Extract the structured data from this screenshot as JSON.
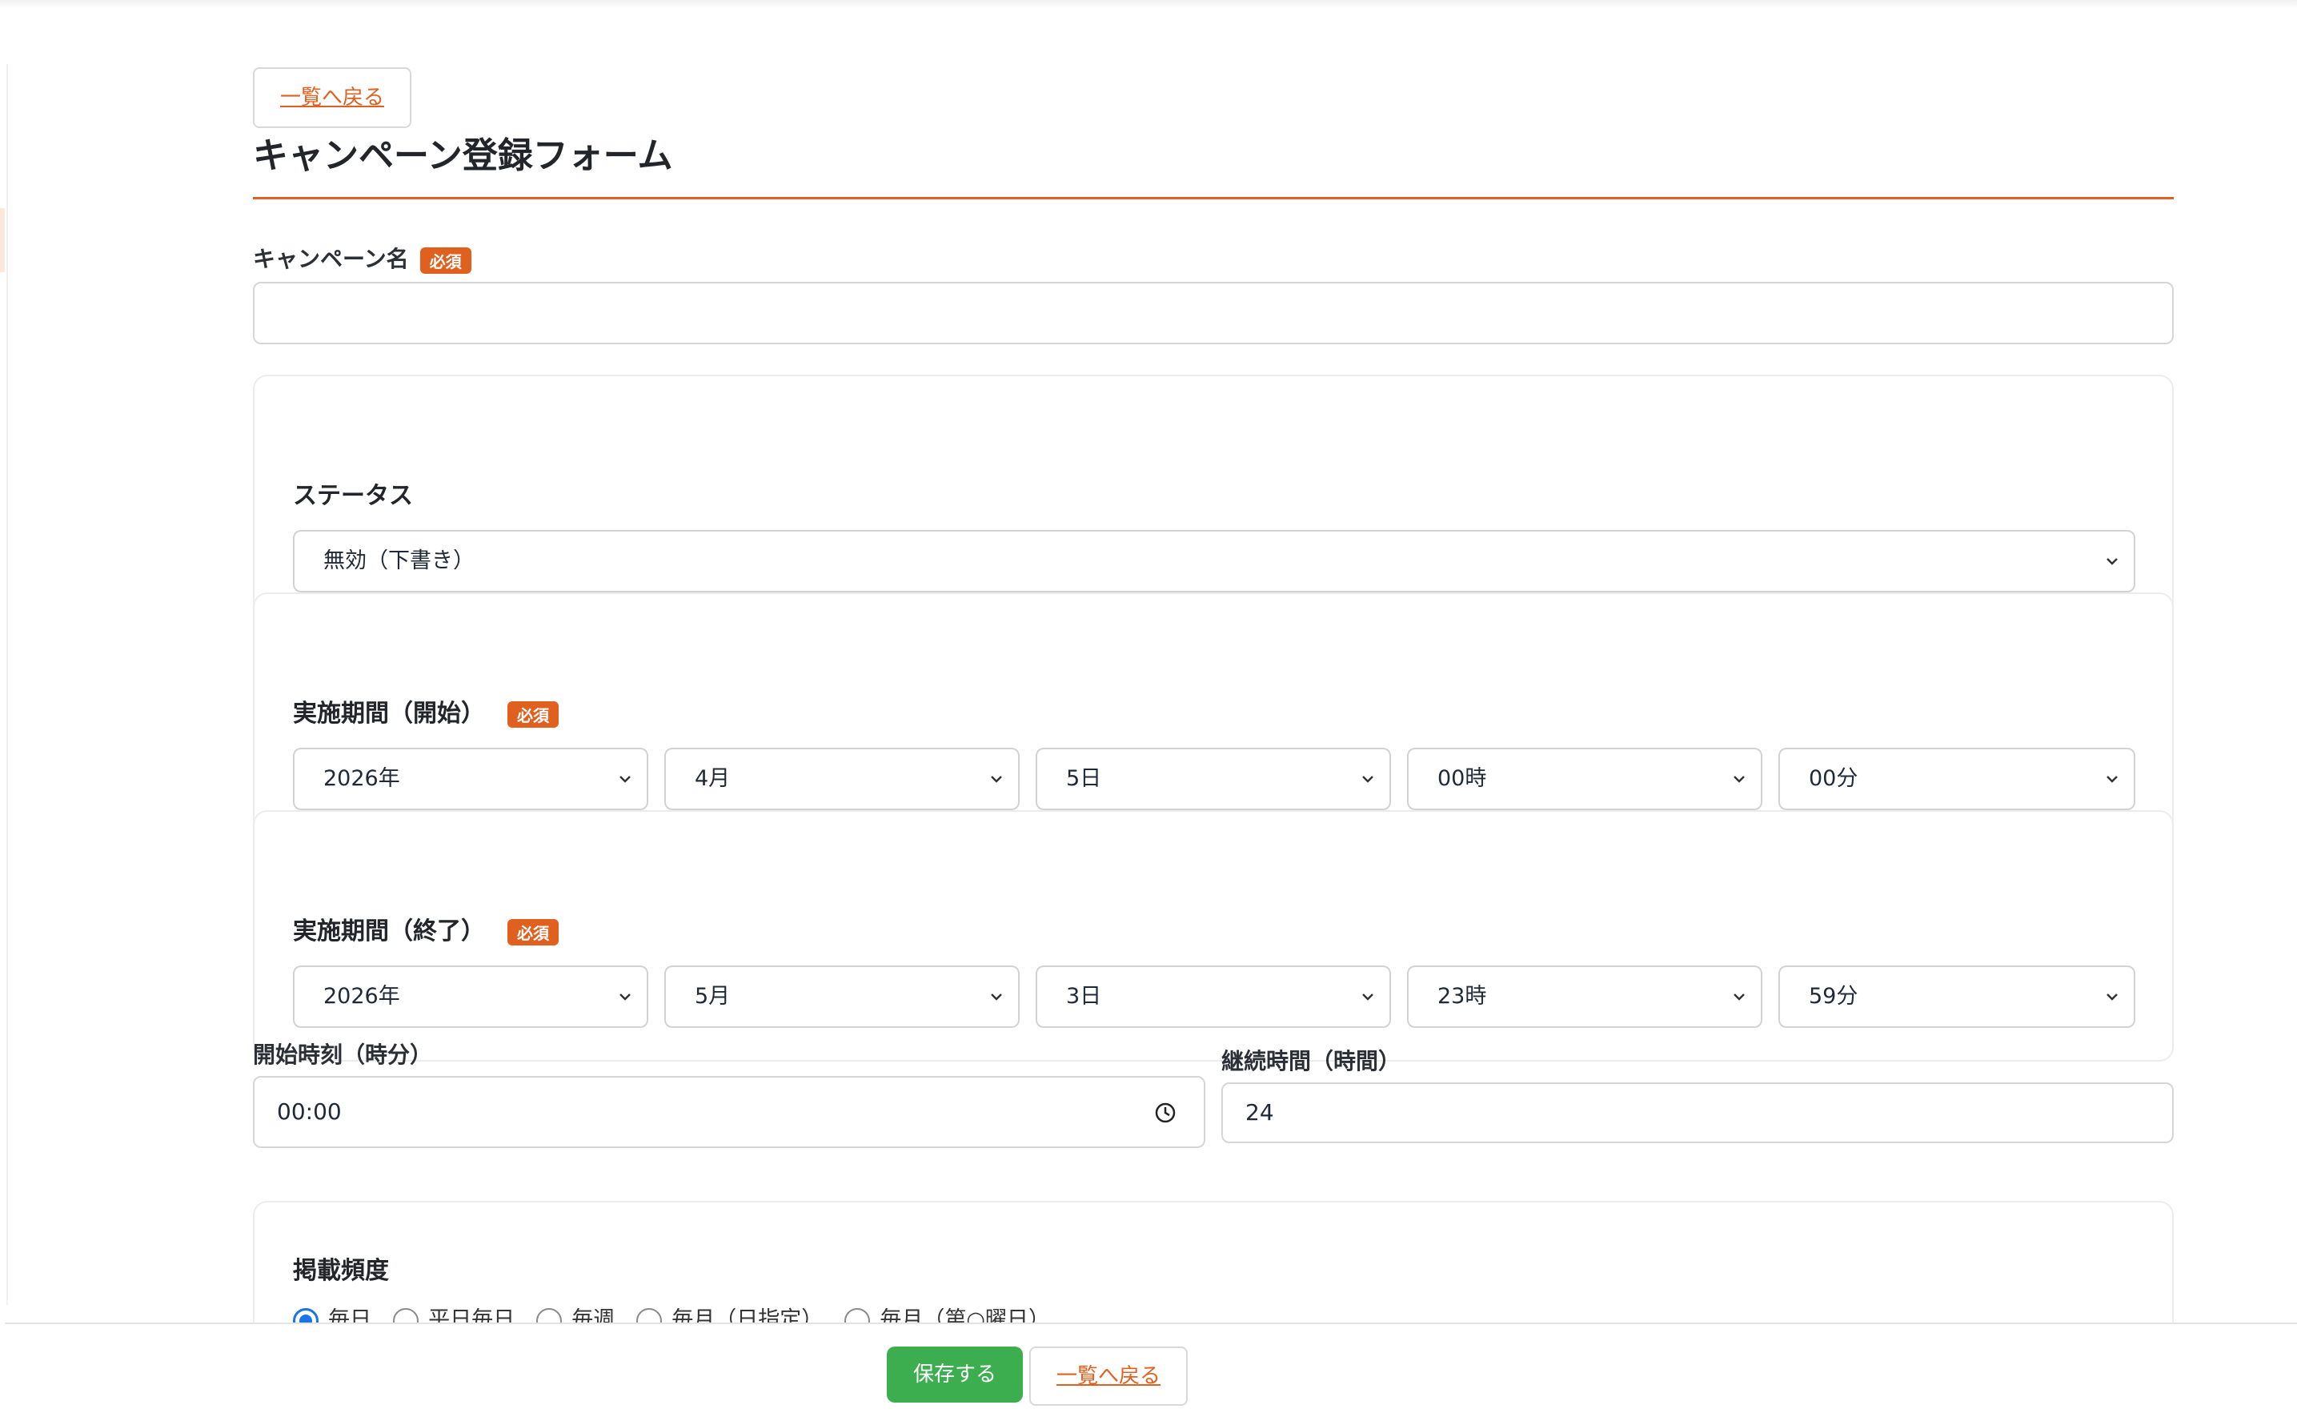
{
  "nav": {
    "back_label": "一覧へ戻る"
  },
  "page": {
    "title": "キャンペーン登録フォーム"
  },
  "colors": {
    "accent": "#e0611f",
    "save": "#3dae4f",
    "radio": "#1a73e8"
  },
  "campaign_name": {
    "label": "キャンペーン名",
    "required": "必須",
    "value": ""
  },
  "status": {
    "title": "ステータス",
    "selected": "無効（下書き）"
  },
  "period_start": {
    "title": "実施期間（開始）",
    "required": "必須",
    "year": "2026年",
    "month": "4月",
    "day": "5日",
    "hour": "00時",
    "minute": "00分"
  },
  "period_end": {
    "title": "実施期間（終了）",
    "required": "必須",
    "year": "2026年",
    "month": "5月",
    "day": "3日",
    "hour": "23時",
    "minute": "59分"
  },
  "start_time": {
    "label": "開始時刻（時分）",
    "value": "00:00",
    "icon": "clock-icon"
  },
  "duration": {
    "label": "継続時間（時間）",
    "value": "24"
  },
  "frequency": {
    "title": "掲載頻度",
    "options": [
      "毎日",
      "平日毎日",
      "毎週",
      "毎月（日指定）",
      "毎月（第○曜日）"
    ],
    "selected": "毎日"
  },
  "footer": {
    "save_label": "保存する",
    "back_label": "一覧へ戻る"
  }
}
